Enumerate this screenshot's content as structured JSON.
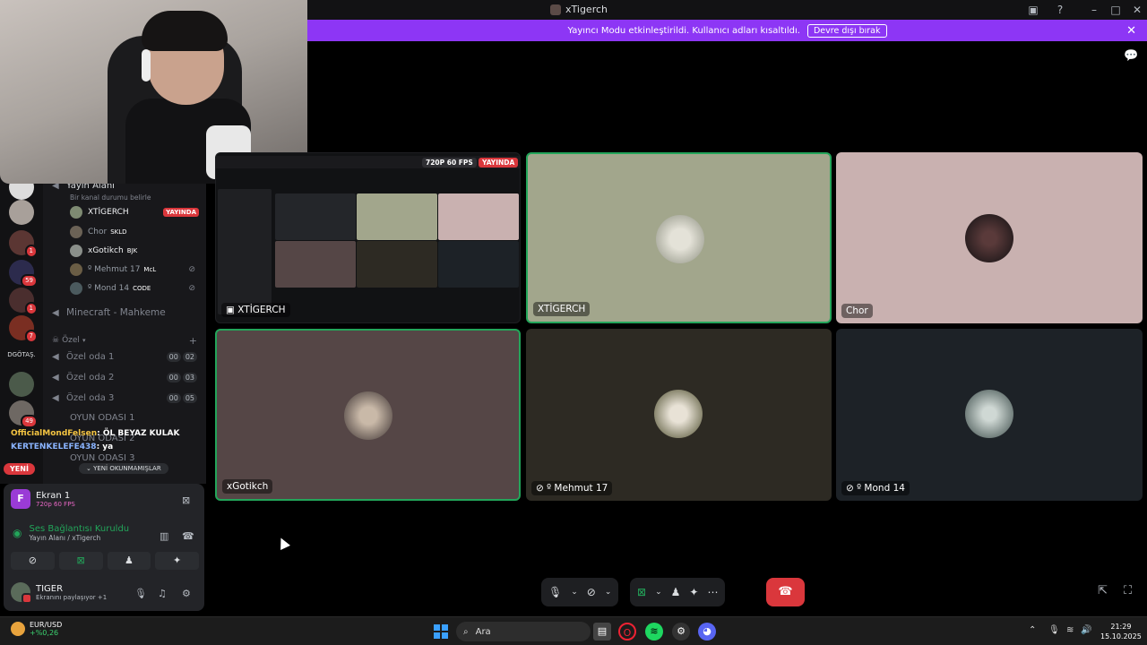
{
  "window": {
    "title": "xTigerch"
  },
  "banner": {
    "text": "Yayıncı Modu etkinleştirildi. Kullanıcı adları kısaltıldı.",
    "button": "Devre dışı bırak"
  },
  "servers": [
    {
      "badge": ""
    },
    {
      "badge": ""
    },
    {
      "badge": "1"
    },
    {
      "badge": "59"
    },
    {
      "badge": "1"
    },
    {
      "badge": "7"
    },
    {
      "badge": ""
    },
    {
      "badge": "49"
    }
  ],
  "server_text": "DGÖTAŞ.",
  "channels": {
    "voice_main": {
      "name": "Yayın Alanı",
      "status": "Bir kanal durumu belirle"
    },
    "users": [
      {
        "name": "XTİGERCH",
        "tag": "",
        "live": "YAYINDA"
      },
      {
        "name": "Chor",
        "tag": "SKLD",
        "live": ""
      },
      {
        "name": "xGotikch",
        "tag": "BJK",
        "live": ""
      },
      {
        "name": "º Mehmut 17",
        "tag": "McL",
        "live": ""
      },
      {
        "name": "º Mond 14",
        "tag": "CODE",
        "live": ""
      }
    ],
    "minecraft": "Minecraft - Mahkeme",
    "category": "Özel",
    "rooms": [
      {
        "name": "Özel oda 1",
        "a": "00",
        "b": "02"
      },
      {
        "name": "Özel oda 2",
        "a": "00",
        "b": "03"
      },
      {
        "name": "Özel oda 3",
        "a": "00",
        "b": "05"
      }
    ],
    "game_rooms": [
      "OYUN ODASI 1",
      "OYUN ODASI 2",
      "OYUN ODASI 3"
    ]
  },
  "chat": [
    {
      "user": "OfficialMondFelsen",
      "msg": ": ÖL BEYAZ KULAK"
    },
    {
      "user": "KERTENKELEFE438",
      "msg": ": ya"
    }
  ],
  "pills": {
    "new": "YENİ",
    "unread": "YENİ OKUNMAMIŞLAR"
  },
  "panel": {
    "screen_title": "Ekran 1",
    "screen_sub": "720p 60 FPS",
    "conn_title": "Ses Bağlantısı Kuruldu",
    "conn_sub": "Yayın Alanı / xTigerch",
    "user_name": "TIGER",
    "user_status": "Ekranını paylaşıyor +1"
  },
  "tiles": {
    "stream": {
      "label": "XTİGERCH",
      "fps": "720P 60 FPS",
      "live": "YAYINDA"
    },
    "tiger": {
      "label": "XTİGERCH"
    },
    "chor": {
      "label": "Chor"
    },
    "xgot": {
      "label": "xGotikch"
    },
    "mehmut": {
      "label": "º Mehmut 17"
    },
    "mond": {
      "label": "º Mond 14"
    }
  },
  "taskbar": {
    "ticker_pair": "EUR/USD",
    "ticker_change": "+%0,26",
    "search": "Ara",
    "time": "21:29",
    "date": "15.10.2025"
  },
  "colors": {
    "accent": "#8d36f5",
    "live": "#da373c",
    "speaking": "#23a55a"
  }
}
